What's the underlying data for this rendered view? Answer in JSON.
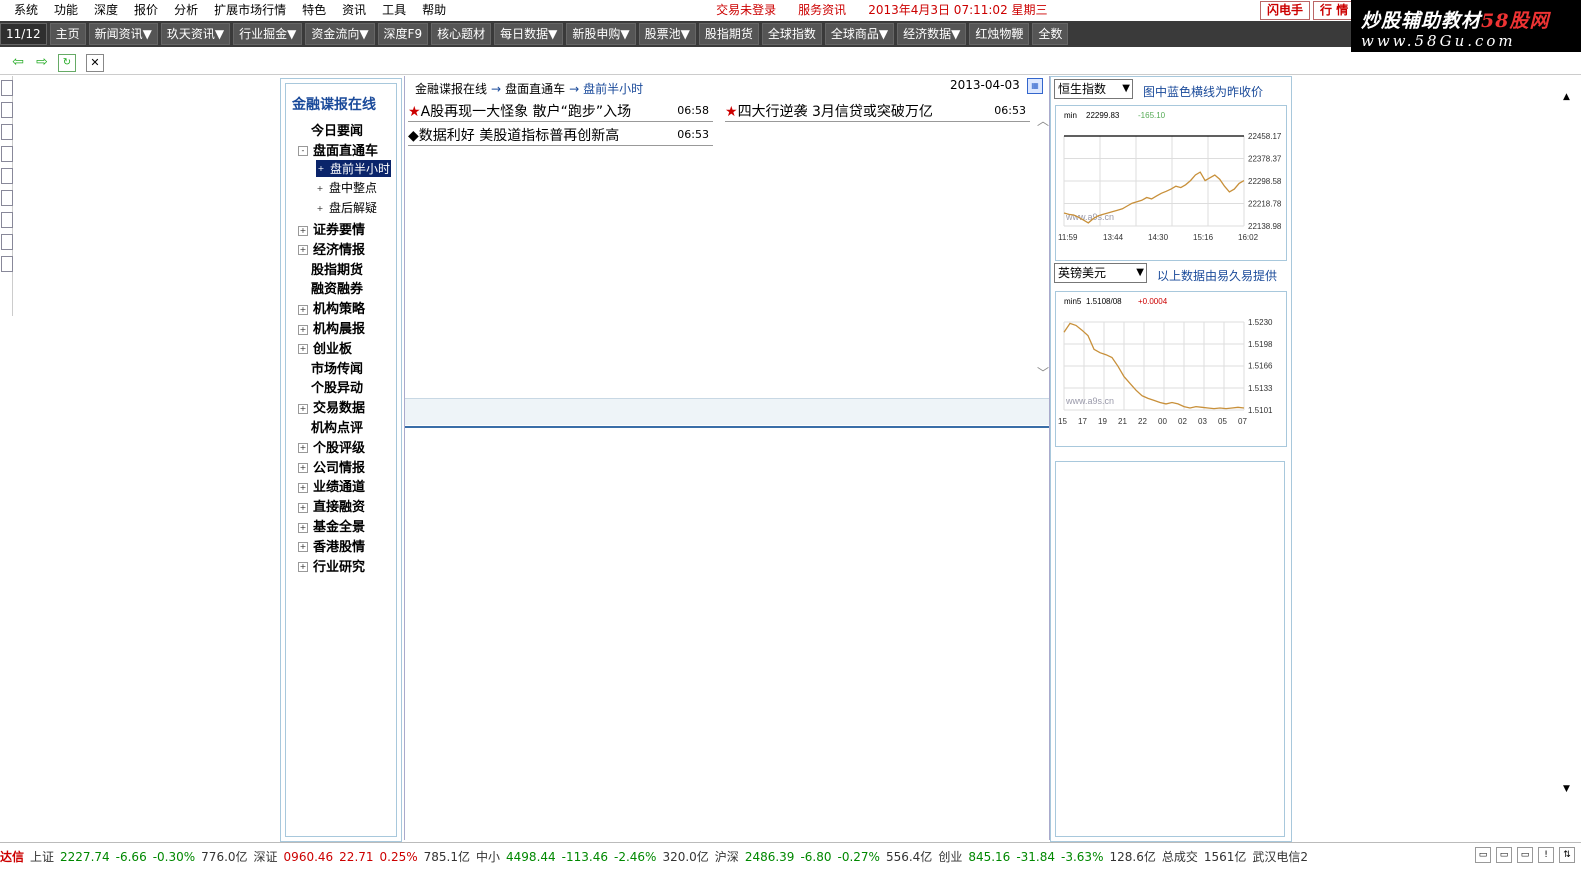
{
  "menu": {
    "items": [
      "系统",
      "功能",
      "深度",
      "报价",
      "分析",
      "扩展市场行情",
      "特色",
      "资讯",
      "工具",
      "帮助"
    ],
    "trade_status": "交易未登录",
    "service": "服务资讯",
    "datetime": "2013年4月3日  07:11:02  星期三",
    "btn_flash": "闪电手",
    "btn_quote": "行 情"
  },
  "brand": {
    "line1_a": "炒股辅助教材",
    "line1_b": "58股网",
    "line2": "www.58Gu.com"
  },
  "toolbar": {
    "page": "11/12",
    "buttons": [
      "主页",
      "新闻资讯▼",
      "玖天资讯▼",
      "行业掘金▼",
      "资金流向▼",
      "深度F9",
      "核心题材",
      "每日数据▼",
      "新股申购▼",
      "股票池▼",
      "股指期货",
      "全球指数",
      "全球商品▼",
      "经济数据▼",
      "红烛物鞭",
      "全数"
    ]
  },
  "tree": {
    "title": "金融谍报在线",
    "items": [
      {
        "label": "今日要闻",
        "pm": ""
      },
      {
        "label": "盘面直通车",
        "pm": "-"
      },
      {
        "label": "盘前半小时",
        "sub": true,
        "selected": true
      },
      {
        "label": "盘中整点",
        "sub": true
      },
      {
        "label": "盘后解疑",
        "sub": true
      },
      {
        "label": "证券要情",
        "pm": "+"
      },
      {
        "label": "经济情报",
        "pm": "+"
      },
      {
        "label": "股指期货",
        "pm": ""
      },
      {
        "label": "融资融券",
        "pm": ""
      },
      {
        "label": "机构策略",
        "pm": "+"
      },
      {
        "label": "机构晨报",
        "pm": "+"
      },
      {
        "label": "创业板",
        "pm": "+"
      },
      {
        "label": "市场传闻",
        "pm": ""
      },
      {
        "label": "个股异动",
        "pm": ""
      },
      {
        "label": "交易数据",
        "pm": "+"
      },
      {
        "label": "机构点评",
        "pm": ""
      },
      {
        "label": "个股评级",
        "pm": "+"
      },
      {
        "label": "公司情报",
        "pm": "+"
      },
      {
        "label": "业绩通道",
        "pm": "+"
      },
      {
        "label": "直接融资",
        "pm": "+"
      },
      {
        "label": "基金全景",
        "pm": "+"
      },
      {
        "label": "香港股情",
        "pm": "+"
      },
      {
        "label": "行业研究",
        "pm": "+"
      }
    ]
  },
  "content": {
    "crumb1": "金融谍报在线",
    "crumb2": "盘面直通车",
    "crumb3": "盘前半小时",
    "arrow": "→",
    "date": "2013-04-03",
    "news": [
      {
        "mark": "★",
        "title": "A股再现一大怪象  散户“跑步”入场",
        "time": "06:58"
      },
      {
        "mark": "★",
        "title": "四大行逆袭  3月信贷或突破万亿",
        "time": "06:53"
      },
      {
        "mark": "◆",
        "title": "数据利好  美股道指标普再创新高",
        "time": "06:53"
      }
    ]
  },
  "right": {
    "select1": "恒生指数",
    "note1": "图中蓝色横线为昨收价",
    "select2": "英镑美元",
    "note2": "以上数据由易久易提供"
  },
  "chart_data": [
    {
      "type": "line",
      "header_label": "min",
      "header_value": "22299.83",
      "header_change": "-165.10",
      "watermark": "www.a9s.cn",
      "x_ticks": [
        "11:59",
        "13:44",
        "14:30",
        "15:16",
        "16:02"
      ],
      "y_ticks": [
        "22458.17",
        "22378.37",
        "22298.58",
        "22218.78",
        "22138.98"
      ],
      "ylim": [
        22138.98,
        22458.17
      ],
      "prev_close": 22458.17,
      "values": [
        22185,
        22180,
        22178,
        22170,
        22160,
        22150,
        22165,
        22175,
        22180,
        22185,
        22190,
        22195,
        22200,
        22210,
        22220,
        22225,
        22230,
        22240,
        22235,
        22245,
        22255,
        22262,
        22270,
        22280,
        22275,
        22285,
        22300,
        22320,
        22330,
        22300,
        22310,
        22320,
        22305,
        22280,
        22260,
        22270,
        22290,
        22300
      ]
    },
    {
      "type": "line",
      "header_label": "min5",
      "header_value": "1.5108/08",
      "header_change": "+0.0004",
      "watermark": "www.a9s.cn",
      "x_ticks": [
        "15",
        "17",
        "19",
        "21",
        "22",
        "00",
        "02",
        "03",
        "05",
        "07"
      ],
      "y_ticks": [
        "1.5230",
        "1.5198",
        "1.5166",
        "1.5133",
        "1.5101"
      ],
      "ylim": [
        1.5101,
        1.523
      ],
      "values": [
        1.5215,
        1.5228,
        1.5225,
        1.5218,
        1.521,
        1.519,
        1.5185,
        1.5182,
        1.5178,
        1.5165,
        1.515,
        1.514,
        1.513,
        1.5122,
        1.5118,
        1.5115,
        1.5112,
        1.511,
        1.5112,
        1.511,
        1.5106,
        1.5104,
        1.5106,
        1.5105,
        1.5104,
        1.5103,
        1.5104,
        1.5103,
        1.5104,
        1.5105,
        1.5104
      ]
    }
  ],
  "ticker": [
    {
      "text": "达信",
      "cls": "hdr"
    },
    {
      "text": "上证",
      "cls": "gray"
    },
    {
      "text": "2227.74",
      "cls": "green"
    },
    {
      "text": "-6.66",
      "cls": "green"
    },
    {
      "text": "-0.30%",
      "cls": "green"
    },
    {
      "text": "776.0亿",
      "cls": "gray"
    },
    {
      "text": "深证",
      "cls": "gray"
    },
    {
      "text": "0960.46",
      "cls": "red"
    },
    {
      "text": "22.71",
      "cls": "red"
    },
    {
      "text": "0.25%",
      "cls": "red"
    },
    {
      "text": "785.1亿",
      "cls": "gray"
    },
    {
      "text": "中小",
      "cls": "gray"
    },
    {
      "text": "4498.44",
      "cls": "green"
    },
    {
      "text": "-113.46",
      "cls": "green"
    },
    {
      "text": "-2.46%",
      "cls": "green"
    },
    {
      "text": "320.0亿",
      "cls": "gray"
    },
    {
      "text": "沪深",
      "cls": "gray"
    },
    {
      "text": "2486.39",
      "cls": "green"
    },
    {
      "text": "-6.80",
      "cls": "green"
    },
    {
      "text": "-0.27%",
      "cls": "green"
    },
    {
      "text": "556.4亿",
      "cls": "gray"
    },
    {
      "text": "创业",
      "cls": "gray"
    },
    {
      "text": "845.16",
      "cls": "green"
    },
    {
      "text": "-31.84",
      "cls": "green"
    },
    {
      "text": "-3.63%",
      "cls": "green"
    },
    {
      "text": "128.6亿",
      "cls": "gray"
    },
    {
      "text": "总成交",
      "cls": "gray"
    },
    {
      "text": "1561亿",
      "cls": "gray"
    },
    {
      "text": "武汉电信2",
      "cls": "gray"
    }
  ]
}
